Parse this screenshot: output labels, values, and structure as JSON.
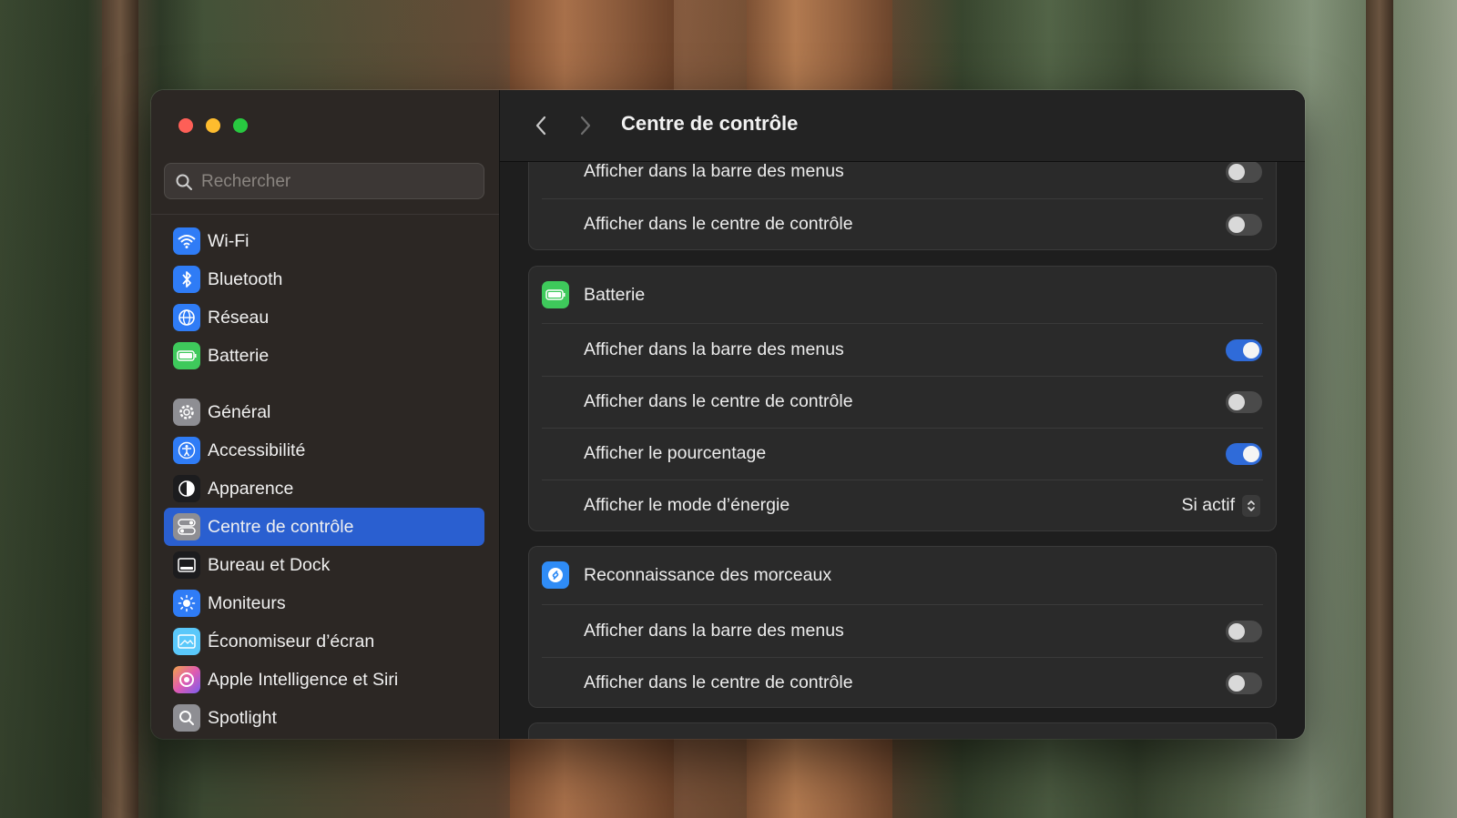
{
  "window": {
    "title": "Centre de contrôle"
  },
  "search": {
    "placeholder": "Rechercher"
  },
  "sidebar": {
    "items": [
      {
        "label": "Wi-Fi",
        "icon": "wifi-icon",
        "color": "#2f7cf6"
      },
      {
        "label": "Bluetooth",
        "icon": "bluetooth-icon",
        "color": "#2f7cf6"
      },
      {
        "label": "Réseau",
        "icon": "globe-icon",
        "color": "#2f7cf6"
      },
      {
        "label": "Batterie",
        "icon": "battery-icon",
        "color": "#3ec95b"
      },
      {
        "label": "Général",
        "icon": "gear-icon",
        "color": "#8e8e93"
      },
      {
        "label": "Accessibilité",
        "icon": "accessibility-icon",
        "color": "#2f7cf6"
      },
      {
        "label": "Apparence",
        "icon": "appearance-icon",
        "color": "#1c1c1e"
      },
      {
        "label": "Centre de contrôle",
        "icon": "control-center-icon",
        "color": "#8e8e93",
        "active": true
      },
      {
        "label": "Bureau et Dock",
        "icon": "dock-icon",
        "color": "#1c1c1e"
      },
      {
        "label": "Moniteurs",
        "icon": "display-icon",
        "color": "#2f7cf6"
      },
      {
        "label": "Économiseur d’écran",
        "icon": "screensaver-icon",
        "color": "#5ac8fa"
      },
      {
        "label": "Apple Intelligence et Siri",
        "icon": "siri-icon",
        "color": "#e05bb0"
      },
      {
        "label": "Spotlight",
        "icon": "spotlight-icon",
        "color": "#8e8e93"
      }
    ]
  },
  "main": {
    "top_group": {
      "rows": [
        {
          "label": "Afficher dans la barre des menus",
          "on": false
        },
        {
          "label": "Afficher dans le centre de contrôle",
          "on": false
        }
      ]
    },
    "battery_group": {
      "title": "Batterie",
      "icon": "battery-icon",
      "rows": [
        {
          "label": "Afficher dans la barre des menus",
          "on": true
        },
        {
          "label": "Afficher dans le centre de contrôle",
          "on": false
        },
        {
          "label": "Afficher le pourcentage",
          "on": true
        }
      ],
      "energy": {
        "label": "Afficher le mode d’énergie",
        "value": "Si actif"
      }
    },
    "shazam_group": {
      "title": "Reconnaissance des morceaux",
      "icon": "shazam-icon",
      "rows": [
        {
          "label": "Afficher dans la barre des menus",
          "on": false
        },
        {
          "label": "Afficher dans le centre de contrôle",
          "on": false
        }
      ]
    }
  },
  "colors": {
    "accent": "#2f6bd9",
    "sidebar_active": "#2a5fd0",
    "close": "#fe5f57",
    "minimize": "#febc2e",
    "zoom": "#28c840"
  }
}
